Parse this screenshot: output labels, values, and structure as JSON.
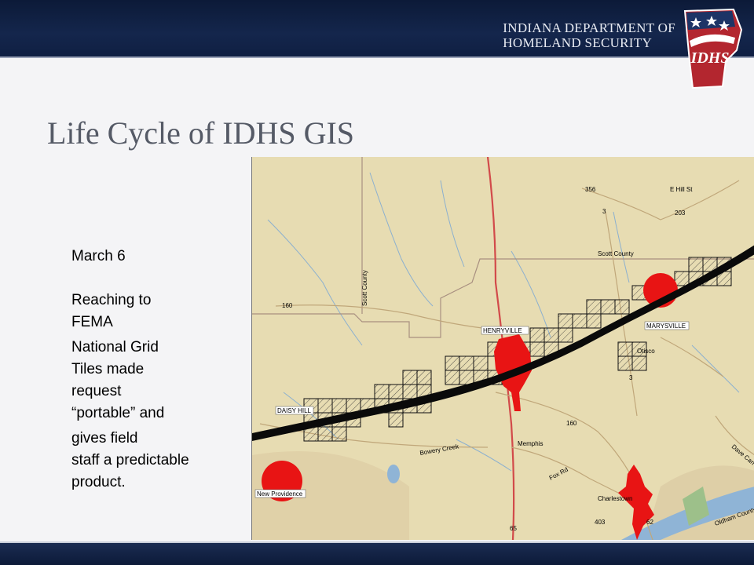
{
  "header": {
    "org_line1": "INDIANA DEPARTMENT OF",
    "org_line2": "HOMELAND SECURITY",
    "logo_text": "IDHS"
  },
  "slide": {
    "title": "Life Cycle of IDHS GIS",
    "bullets": {
      "date": "March 6",
      "reaching_1": "Reaching  to",
      "reaching_2": "FEMA",
      "grid_1": "National Grid",
      "grid_2": "Tiles made",
      "grid_3": "request",
      "grid_4": "“portable”  and",
      "field_1": "gives field",
      "field_2": "staff a predictable",
      "field_3": "product."
    }
  },
  "map": {
    "places": {
      "henryville": "HENRYVILLE",
      "marysville": "MARYSVILLE",
      "daisy_hill": "DAISY HILL",
      "new_providence": "New Providence",
      "memphis": "Memphis",
      "otisco": "Otisco",
      "charlestown": "Charlestown",
      "scott_county_h": "Scott County",
      "scott_county_v": "Scott County",
      "oldham_county": "Oldham County"
    },
    "roads": {
      "fox_rd": "Fox Rd",
      "e_hill_st": "E Hill St",
      "dave_carr_rd": "Dave Carr Rd",
      "bowery_creek": "Bowery Creek",
      "route_160": "160",
      "route_3": "3",
      "route_356": "356",
      "route_203": "203",
      "route_403": "403",
      "route_62": "62",
      "route_65": "65"
    },
    "colors": {
      "base": "#e7dcb2",
      "impact": "#e81414",
      "track": "#0a0a0a",
      "water": "#8fb4d6",
      "park": "#9dc08a"
    }
  }
}
